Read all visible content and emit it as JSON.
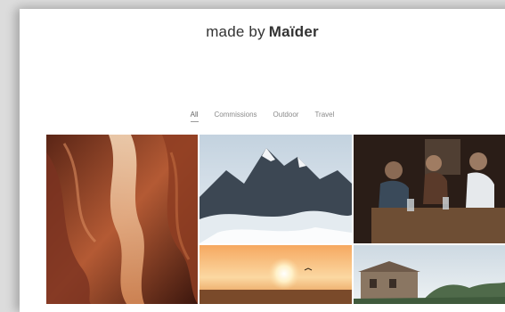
{
  "site": {
    "title_plain": "made by",
    "title_bold": "Maïder"
  },
  "filters": [
    {
      "label": "All",
      "active": true
    },
    {
      "label": "Commissions",
      "active": false
    },
    {
      "label": "Outdoor",
      "active": false
    },
    {
      "label": "Travel",
      "active": false
    }
  ],
  "gallery": {
    "items": [
      {
        "subject": "canyon"
      },
      {
        "subject": "snowy-mountains"
      },
      {
        "subject": "group-at-table"
      },
      {
        "subject": "sunset-sea"
      },
      {
        "subject": "stone-house"
      }
    ]
  },
  "colors": {
    "canyon": "#a24a2c",
    "mountain_sky": "#cfdbe6",
    "interior": "#3a2a22",
    "sunset": "#f3b15f",
    "house_sky": "#d9e3ea"
  }
}
